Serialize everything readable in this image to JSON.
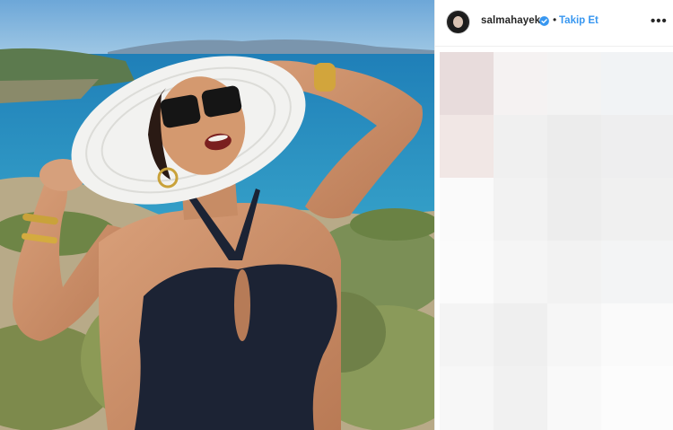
{
  "post": {
    "username": "salmahayek",
    "separator": "•",
    "follow_label": "Takip Et",
    "more_label": "•••",
    "verified": true,
    "accent_color": "#3897f0",
    "comments_blurred": true
  }
}
